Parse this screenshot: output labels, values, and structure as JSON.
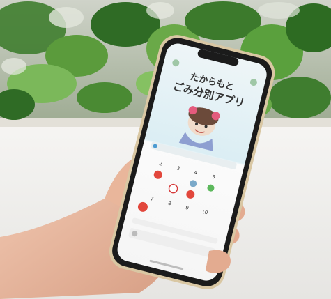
{
  "photo": {
    "background_colors": {
      "foliage": "#4b8a36",
      "wall": "#f2f1ee",
      "hand": "#e8b49a",
      "phone_frame": "#d9c7a3"
    }
  },
  "phone_screen": {
    "app_title_line1": "たからもと",
    "app_title_line2": "ごみ分別アプリ",
    "accent_color": "#dff0f5",
    "status_bar_time": "",
    "calendar_dates_row1": [
      "2",
      "3",
      "4",
      "5"
    ],
    "calendar_dates_row2": [
      "7",
      "8",
      "9",
      "10"
    ],
    "icons": [
      "flame-icon",
      "recycle-icon",
      "no-entry-icon",
      "bottle-icon",
      "gear-icon",
      "hamburger-icon"
    ]
  }
}
